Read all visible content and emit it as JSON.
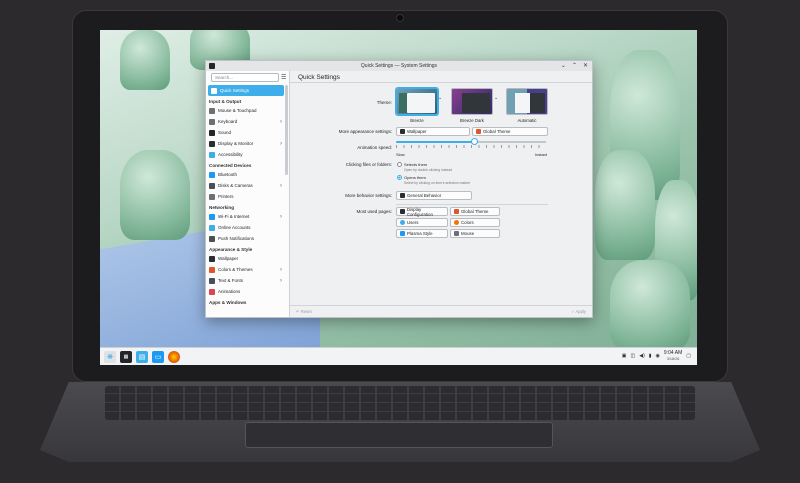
{
  "window": {
    "title": "Quick Settings — System Settings"
  },
  "sidebar": {
    "search_placeholder": "Search...",
    "groups": [
      {
        "items": [
          {
            "label": "Quick Settings",
            "color": "#3daee9",
            "selected": true
          }
        ]
      },
      {
        "heading": "Input & Output",
        "items": [
          {
            "label": "Mouse & Touchpad",
            "color": "#6c7075"
          },
          {
            "label": "Keyboard",
            "color": "#6c7075",
            "chevron": true
          },
          {
            "label": "Sound",
            "color": "#232629"
          },
          {
            "label": "Display & Monitor",
            "color": "#2a2e32",
            "chevron": true
          },
          {
            "label": "Accessibility",
            "color": "#3daee9"
          }
        ]
      },
      {
        "heading": "Connected Devices",
        "items": [
          {
            "label": "Bluetooth",
            "color": "#1d99f3"
          },
          {
            "label": "Disks & Cameras",
            "color": "#4a4f55",
            "chevron": true
          },
          {
            "label": "Printers",
            "color": "#6c7075"
          }
        ]
      },
      {
        "heading": "Networking",
        "items": [
          {
            "label": "Wi-Fi & Internet",
            "color": "#1d99f3",
            "chevron": true
          },
          {
            "label": "Online Accounts",
            "color": "#3daee9"
          },
          {
            "label": "Push Notifications",
            "color": "#4a4f55"
          }
        ]
      },
      {
        "heading": "Appearance & Style",
        "items": [
          {
            "label": "Wallpaper",
            "color": "#2a2e32"
          },
          {
            "label": "Colors & Themes",
            "color": "#e0562a",
            "chevron": true
          },
          {
            "label": "Text & Fonts",
            "color": "#4a4f55",
            "chevron": true
          },
          {
            "label": "Animations",
            "color": "#da4453"
          }
        ]
      },
      {
        "heading": "Apps & Windows",
        "items": []
      }
    ]
  },
  "main": {
    "title": "Quick Settings",
    "theme_label": "Theme:",
    "themes": [
      {
        "name": "Breeze",
        "selected": true
      },
      {
        "name": "Breeze Dark"
      },
      {
        "name": "Automatic"
      }
    ],
    "more_appearance_label": "More appearance settings:",
    "wallpaper_btn": "Wallpaper",
    "global_theme_btn": "Global Theme",
    "animation_label": "Animation speed:",
    "slow_label": "Slow",
    "instant_label": "Instant",
    "animation_speed_percent": 52,
    "click_label": "Clicking files or folders:",
    "select_option": "Selects them",
    "select_hint": "Open by double-clicking instead",
    "open_option": "Opens them",
    "open_hint": "Select by clicking on item's selection marker",
    "more_behavior_label": "More behavior settings:",
    "general_behavior_btn": "General Behavior",
    "most_used_label": "Most used pages:",
    "most_used": [
      {
        "label": "Display Configuration",
        "color": "#2a2e32"
      },
      {
        "label": "Global Theme",
        "color": "#e0562a"
      },
      {
        "label": "Users",
        "color": "#3daee9"
      },
      {
        "label": "Colors",
        "color": "#f67400"
      },
      {
        "label": "Plasma Style",
        "color": "#1d99f3"
      },
      {
        "label": "Mouse",
        "color": "#6c7075"
      }
    ],
    "reset_label": "Reset",
    "apply_label": "Apply"
  },
  "taskbar": {
    "time": "9:04 AM",
    "date": "3/18/26"
  }
}
